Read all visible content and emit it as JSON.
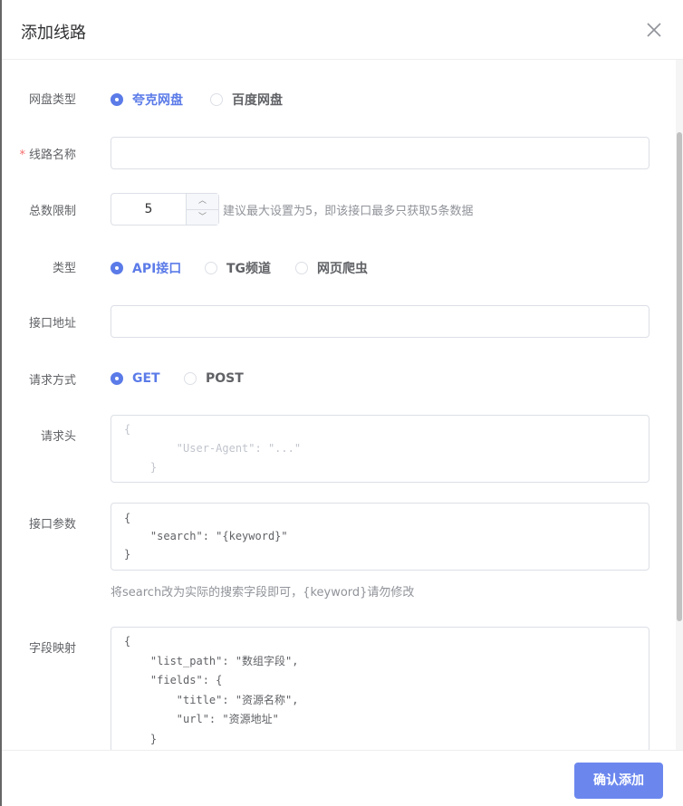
{
  "dialog": {
    "title": "添加线路",
    "confirm_label": "确认添加"
  },
  "form": {
    "disk_type": {
      "label": "网盘类型",
      "options": [
        "夸克网盘",
        "百度网盘"
      ],
      "selected": "夸克网盘"
    },
    "route_name": {
      "label": "线路名称",
      "value": ""
    },
    "total_limit": {
      "label": "总数限制",
      "value": "5",
      "hint": "建议最大设置为5，即该接口最多只获取5条数据"
    },
    "type": {
      "label": "类型",
      "options": [
        "API接口",
        "TG频道",
        "网页爬虫"
      ],
      "selected": "API接口"
    },
    "api_url": {
      "label": "接口地址",
      "value": ""
    },
    "method": {
      "label": "请求方式",
      "options": [
        "GET",
        "POST"
      ],
      "selected": "GET"
    },
    "headers": {
      "label": "请求头",
      "placeholder": "{\n        \"User-Agent\": \"...\"\n    }"
    },
    "params": {
      "label": "接口参数",
      "value": "{\n    \"search\": \"{keyword}\"\n}",
      "hint": "将search改为实际的搜索字段即可，{keyword}请勿修改"
    },
    "mapping": {
      "label": "字段映射",
      "value": "{\n    \"list_path\": \"数组字段\",\n    \"fields\": {\n        \"title\": \"资源名称\",\n        \"url\": \"资源地址\"\n    }"
    }
  }
}
